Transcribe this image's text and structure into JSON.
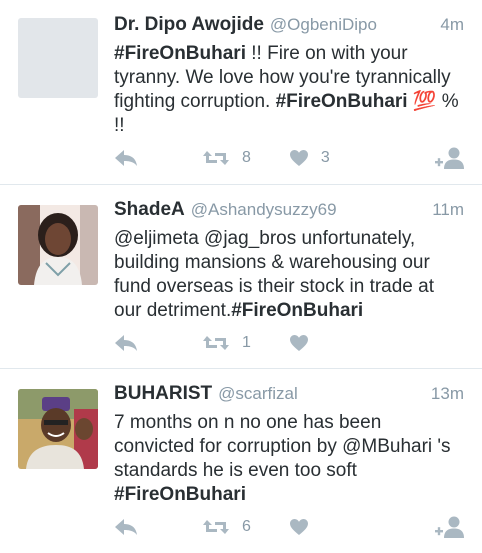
{
  "tweets": [
    {
      "name": "Dr. Dipo Awojide",
      "handle": "@OgbeniDipo",
      "time": "4m",
      "body": [
        {
          "text": "#FireOnBuhari",
          "hl": true
        },
        {
          "text": " !! Fire on with your tyranny. We love how you're tyrannically fighting corruption. ",
          "hl": false
        },
        {
          "text": "#FireOnBuhari",
          "hl": true
        },
        {
          "text": " 💯 % !!",
          "hl": false
        }
      ],
      "retweets": "8",
      "likes": "3",
      "avatar": "blank"
    },
    {
      "name": "ShadeA",
      "handle": "@Ashandysuzzy69",
      "time": "11m",
      "body": [
        {
          "text": "@eljimeta @jag_bros unfortunately, building mansions & warehousing our fund overseas is their stock in trade at our detriment.",
          "hl": false
        },
        {
          "text": "#FireOnBuhari",
          "hl": true
        }
      ],
      "retweets": "1",
      "likes": "",
      "avatar": "photo-woman"
    },
    {
      "name": "BUHARIST",
      "handle": "@scarfizal",
      "time": "13m",
      "body": [
        {
          "text": "7 months on n no one has been convicted for corruption by @MBuhari 's standards he is even too soft ",
          "hl": false
        },
        {
          "text": "#FireOnBuhari",
          "hl": true
        }
      ],
      "retweets": "6",
      "likes": "",
      "avatar": "photo-man"
    }
  ],
  "icons": {
    "reply": "reply-icon",
    "retweet": "retweet-icon",
    "like": "heart-icon",
    "follow": "follow-icon"
  },
  "colors": {
    "icon": "#aab8c2",
    "meta": "#8899a6",
    "text": "#292f33"
  }
}
